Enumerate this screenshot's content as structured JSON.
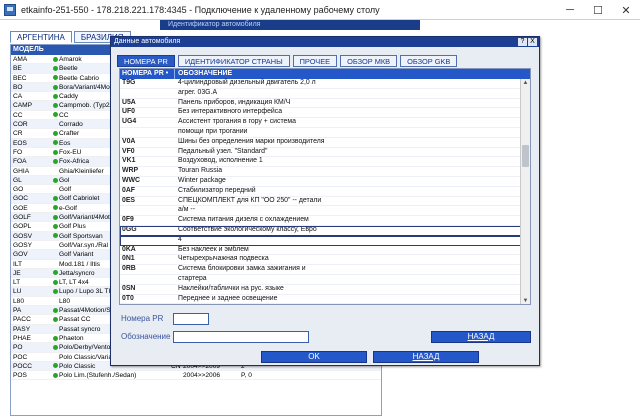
{
  "rdp": {
    "title": "etkainfo-251-550 - 178.218.221.178:4345 - Подключение к удаленному рабочему столу",
    "buttons": [
      "─",
      "☐",
      "✕"
    ]
  },
  "background": {
    "topstrip": "Идентификатор автомобиля",
    "tabs": [
      "АРГЕНТИНА",
      "БРАЗИЛИЯ"
    ],
    "models_header": "МОДЕЛЬ",
    "models": [
      {
        "code": "AMA",
        "dot": true,
        "name": "Amarok",
        "cn": "",
        "years": "",
        "r": ""
      },
      {
        "code": "BE",
        "dot": true,
        "name": "Beetle",
        "cn": "",
        "years": "",
        "r": ""
      },
      {
        "code": "BEC",
        "dot": true,
        "name": "Beetle Cabrio",
        "cn": "",
        "years": "",
        "r": ""
      },
      {
        "code": "BO",
        "dot": true,
        "name": "Bora/Variant/4Mo",
        "cn": "",
        "years": "",
        "r": ""
      },
      {
        "code": "CA",
        "dot": true,
        "name": "Caddy",
        "cn": "",
        "years": "",
        "r": ""
      },
      {
        "code": "CAMP",
        "dot": true,
        "name": "Campmob. (Typ2/",
        "cn": "",
        "years": "",
        "r": ""
      },
      {
        "code": "CC",
        "dot": true,
        "name": "CC",
        "cn": "",
        "years": "",
        "r": ""
      },
      {
        "code": "COR",
        "dot": false,
        "name": "Corrado",
        "cn": "",
        "years": "",
        "r": ""
      },
      {
        "code": "CR",
        "dot": true,
        "name": "Crafter",
        "cn": "",
        "years": "",
        "r": ""
      },
      {
        "code": "EOS",
        "dot": true,
        "name": "Eos",
        "cn": "",
        "years": "",
        "r": ""
      },
      {
        "code": "FO",
        "dot": true,
        "name": "Fox-EU",
        "cn": "",
        "years": "",
        "r": ""
      },
      {
        "code": "FOA",
        "dot": true,
        "name": "Fox-Africa",
        "cn": "",
        "years": "",
        "r": ""
      },
      {
        "code": "GHIA",
        "dot": false,
        "name": "Ghia/Kleinliefer",
        "cn": "",
        "years": "",
        "r": ""
      },
      {
        "code": "GL",
        "dot": true,
        "name": "Gol",
        "cn": "",
        "years": "",
        "r": ""
      },
      {
        "code": "GO",
        "dot": false,
        "name": "Golf",
        "cn": "",
        "years": "",
        "r": ""
      },
      {
        "code": "GOC",
        "dot": true,
        "name": "Golf Cabriolet",
        "cn": "",
        "years": "",
        "r": ""
      },
      {
        "code": "GOE",
        "dot": true,
        "name": "e-Golf",
        "cn": "",
        "years": "",
        "r": ""
      },
      {
        "code": "GOLF",
        "dot": true,
        "name": "Golf/Variant/4Mot",
        "cn": "",
        "years": "",
        "r": ""
      },
      {
        "code": "GOPL",
        "dot": true,
        "name": "Golf Plus",
        "cn": "",
        "years": "",
        "r": ""
      },
      {
        "code": "GOSV",
        "dot": true,
        "name": "Golf Sportsvan",
        "cn": "",
        "years": "",
        "r": ""
      },
      {
        "code": "GOSY",
        "dot": false,
        "name": "Golf/Var.syn./Ral",
        "cn": "",
        "years": "",
        "r": ""
      },
      {
        "code": "GOV",
        "dot": false,
        "name": "Golf Variant",
        "cn": "",
        "years": "",
        "r": ""
      },
      {
        "code": "ILT",
        "dot": false,
        "name": "Mod.181 / Iltis",
        "cn": "",
        "years": "",
        "r": ""
      },
      {
        "code": "JE",
        "dot": true,
        "name": "Jetta/syncro",
        "cn": "",
        "years": "",
        "r": ""
      },
      {
        "code": "LT",
        "dot": true,
        "name": "LT, LT 4x4",
        "cn": "",
        "years": "",
        "r": ""
      },
      {
        "code": "LU",
        "dot": true,
        "name": "Lupo / Lupo 3L TI",
        "cn": "",
        "years": "",
        "r": ""
      },
      {
        "code": "L80",
        "dot": false,
        "name": "L80",
        "cn": "",
        "years": "",
        "r": ""
      },
      {
        "code": "PA",
        "dot": true,
        "name": "Passat/4Motion/S",
        "cn": "",
        "years": "",
        "r": ""
      },
      {
        "code": "PACC",
        "dot": true,
        "name": "Passat CC",
        "cn": "",
        "years": "",
        "r": ""
      },
      {
        "code": "PASY",
        "dot": false,
        "name": "Passat syncro",
        "cn": "",
        "years": "",
        "r": ""
      },
      {
        "code": "PHAE",
        "dot": true,
        "name": "Phaeton",
        "cn": "",
        "years": "",
        "r": ""
      },
      {
        "code": "PO",
        "dot": true,
        "name": "Polo/Derby/Vento-IND",
        "cn": "",
        "years": "",
        "r": ""
      },
      {
        "code": "POC",
        "dot": false,
        "name": "Polo Classic/Variant",
        "cn": "",
        "years": "1996>>2002",
        "r": "R"
      },
      {
        "code": "POCC",
        "dot": true,
        "name": "Polo Classic",
        "cn": "CN",
        "years": "2004>>2009",
        "r": "2"
      },
      {
        "code": "POS",
        "dot": true,
        "name": "Polo Lim.(Stufenh./Sedan)",
        "cn": "",
        "years": "2004>>2006",
        "r": "P, 0"
      }
    ]
  },
  "dialog": {
    "title": "Данные автомобиля",
    "title_buttons": [
      "?",
      "X"
    ],
    "tabs": [
      "НОМЕРА PR",
      "ИДЕНТИФИКАТОР СТРАНЫ",
      "ПРОЧЕЕ",
      "ОБЗОР МКВ",
      "ОБЗОР GKB"
    ],
    "active_tab": 0,
    "list_header": {
      "code": "НОМЕРА PR  •",
      "desc": "ОБОЗНАЧЕНИЕ"
    },
    "rows": [
      {
        "code": "T9G",
        "desc": "4-цилиндровый дизельный двигатель 2,0 л"
      },
      {
        "code": "",
        "desc": "агрег. 03G.A"
      },
      {
        "code": "U5A",
        "desc": "Панель приборов, индикация КМ/Ч"
      },
      {
        "code": "UF0",
        "desc": "Без интерактивного интерфейса"
      },
      {
        "code": "UG4",
        "desc": "Ассистент трогания в гору + система"
      },
      {
        "code": "",
        "desc": "помощи при трогании"
      },
      {
        "code": "V0A",
        "desc": "Шины без определения марки производителя"
      },
      {
        "code": "VF0",
        "desc": "Педальный узел. \"Standard\""
      },
      {
        "code": "VK1",
        "desc": "Воздуховод, исполнение 1"
      },
      {
        "code": "WRP",
        "desc": "Touran Russia"
      },
      {
        "code": "WWC",
        "desc": "Winter package"
      },
      {
        "code": "0AF",
        "desc": "Стабилизатор передний"
      },
      {
        "code": "0ES",
        "desc": "СПЕЦКОМПЛЕКТ для КП \"ОО 250\" -- детали"
      },
      {
        "code": "",
        "desc": "а/м --"
      },
      {
        "code": "0F9",
        "desc": "Система питания дизеля с охлаждением"
      },
      {
        "code": "0GG",
        "desc": "Соответствие экологическому классу, Евро",
        "selected": true
      },
      {
        "code": "",
        "desc": "4",
        "selected": true
      },
      {
        "code": "0KA",
        "desc": "Без наклеек и эмблем"
      },
      {
        "code": "0N1",
        "desc": "Четырехрычажная подвеска"
      },
      {
        "code": "0RB",
        "desc": "Система блокировки замка зажигания и"
      },
      {
        "code": "",
        "desc": "стартера"
      },
      {
        "code": "0SN",
        "desc": "Наклейки/таблички на рус. языке"
      },
      {
        "code": "0T0",
        "desc": "Переднее и заднее освещение"
      }
    ],
    "form": {
      "pr_label": "Номера PR",
      "pr_value": "",
      "desc_label": "Обозначение",
      "desc_value": "",
      "back_inline": "НАЗАД"
    },
    "ok_label": "OK",
    "back_label": "НАЗАД"
  }
}
